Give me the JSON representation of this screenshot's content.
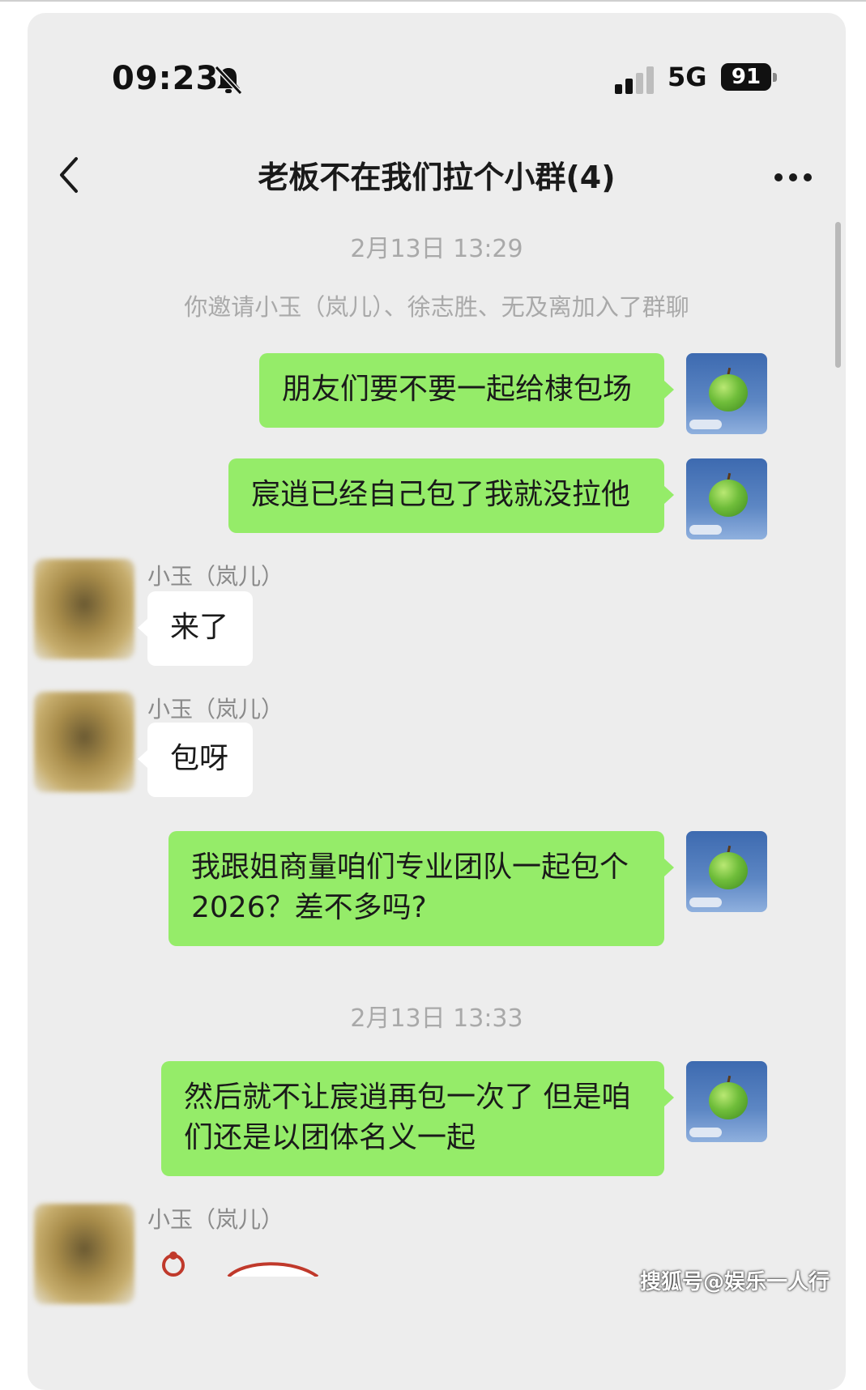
{
  "status_bar": {
    "time": "09:23",
    "network": "5G",
    "battery": "91"
  },
  "header": {
    "title": "老板不在我们拉个小群(4)"
  },
  "messages": [
    {
      "type": "timestamp",
      "text": "2月13日 13:29"
    },
    {
      "type": "system",
      "text": "你邀请小玉（岚儿）、徐志胜、无及离加入了群聊"
    },
    {
      "type": "outgoing",
      "text": "朋友们要不要一起给棣包场"
    },
    {
      "type": "outgoing",
      "text": "宸逍已经自己包了我就没拉他"
    },
    {
      "type": "incoming",
      "sender": "小玉（岚儿）",
      "text": "来了"
    },
    {
      "type": "incoming",
      "sender": "小玉（岚儿）",
      "text": "包呀"
    },
    {
      "type": "outgoing",
      "text": "我跟姐商量咱们专业团队一起包个2026？差不多吗?"
    },
    {
      "type": "timestamp",
      "text": "2月13日 13:33"
    },
    {
      "type": "outgoing",
      "text": "然后就不让宸逍再包一次了 但是咱们还是以团体名义一起"
    },
    {
      "type": "incoming",
      "sender": "小玉（岚儿）",
      "text": ""
    }
  ],
  "watermark": "搜狐号@娱乐一人行",
  "colors": {
    "background": "#ededed",
    "outgoing_bubble": "#95ec69",
    "incoming_bubble": "#ffffff",
    "meta_text": "#a9a9a9"
  },
  "icons": [
    "bell-slash-icon",
    "signal-icon",
    "battery-icon",
    "back-chevron-icon",
    "more-dots-icon"
  ]
}
